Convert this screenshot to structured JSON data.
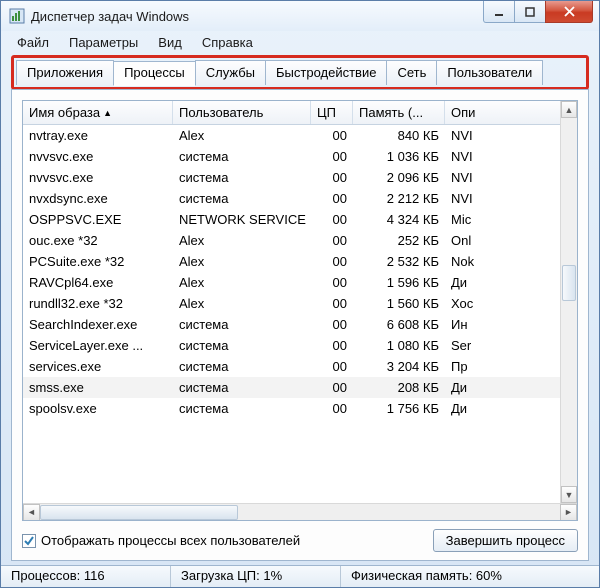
{
  "window": {
    "title": "Диспетчер задач Windows"
  },
  "menubar": [
    "Файл",
    "Параметры",
    "Вид",
    "Справка"
  ],
  "tabs": {
    "items": [
      "Приложения",
      "Процессы",
      "Службы",
      "Быстродействие",
      "Сеть",
      "Пользователи"
    ],
    "active_index": 1
  },
  "columns": {
    "name": "Имя образа",
    "user": "Пользователь",
    "cpu": "ЦП",
    "mem": "Память (...",
    "desc": "Опи"
  },
  "rows": [
    {
      "name": "nvtray.exe",
      "user": "Alex",
      "cpu": "00",
      "mem": "840 КБ",
      "desc": "NVI"
    },
    {
      "name": "nvvsvc.exe",
      "user": "система",
      "cpu": "00",
      "mem": "1 036 КБ",
      "desc": "NVI"
    },
    {
      "name": "nvvsvc.exe",
      "user": "система",
      "cpu": "00",
      "mem": "2 096 КБ",
      "desc": "NVI"
    },
    {
      "name": "nvxdsync.exe",
      "user": "система",
      "cpu": "00",
      "mem": "2 212 КБ",
      "desc": "NVI"
    },
    {
      "name": "OSPPSVC.EXE",
      "user": "NETWORK SERVICE",
      "cpu": "00",
      "mem": "4 324 КБ",
      "desc": "Mic"
    },
    {
      "name": "ouc.exe *32",
      "user": "Alex",
      "cpu": "00",
      "mem": "252 КБ",
      "desc": "Onl"
    },
    {
      "name": "PCSuite.exe *32",
      "user": "Alex",
      "cpu": "00",
      "mem": "2 532 КБ",
      "desc": "Nok"
    },
    {
      "name": "RAVCpl64.exe",
      "user": "Alex",
      "cpu": "00",
      "mem": "1 596 КБ",
      "desc": "Ди"
    },
    {
      "name": "rundll32.exe *32",
      "user": "Alex",
      "cpu": "00",
      "mem": "1 560 КБ",
      "desc": "Хос"
    },
    {
      "name": "SearchIndexer.exe",
      "user": "система",
      "cpu": "00",
      "mem": "6 608 КБ",
      "desc": "Ин"
    },
    {
      "name": "ServiceLayer.exe ...",
      "user": "система",
      "cpu": "00",
      "mem": "1 080 КБ",
      "desc": "Ser"
    },
    {
      "name": "services.exe",
      "user": "система",
      "cpu": "00",
      "mem": "3 204 КБ",
      "desc": "Пр"
    },
    {
      "name": "smss.exe",
      "user": "система",
      "cpu": "00",
      "mem": "208 КБ",
      "desc": "Ди",
      "selected": true
    },
    {
      "name": "spoolsv.exe",
      "user": "система",
      "cpu": "00",
      "mem": "1 756 КБ",
      "desc": "Ди"
    }
  ],
  "show_all_users": {
    "label": "Отображать процессы всех пользователей",
    "checked": true
  },
  "end_process_btn": "Завершить процесс",
  "status": {
    "processes": "Процессов: 116",
    "cpu": "Загрузка ЦП: 1%",
    "mem": "Физическая память: 60%"
  }
}
